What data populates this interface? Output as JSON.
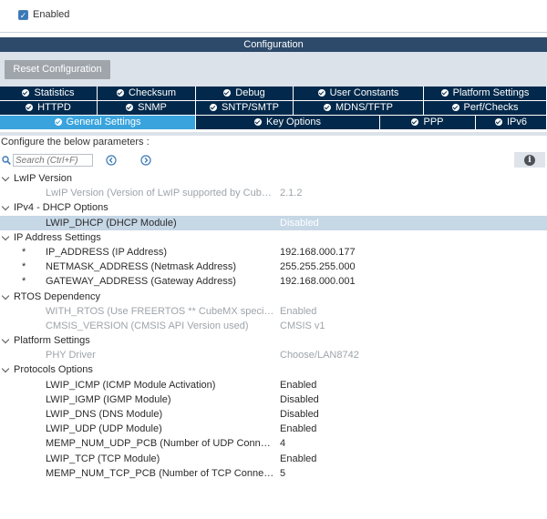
{
  "enabled": {
    "label": "Enabled",
    "checked": true
  },
  "config_header": "Configuration",
  "reset_button": "Reset Configuration",
  "tabs_row1": [
    "Statistics",
    "Checksum",
    "Debug",
    "User Constants",
    "Platform Settings"
  ],
  "tabs_row2": [
    "HTTPD",
    "SNMP",
    "SNTP/SMTP",
    "MDNS/TFTP",
    "Perf/Checks"
  ],
  "tabs_row3": [
    "General Settings",
    "Key Options",
    "PPP",
    "IPv6"
  ],
  "active_tab": "General Settings",
  "configure_label": "Configure the below parameters :",
  "search": {
    "placeholder": "Search (Ctrl+F)"
  },
  "colors": {
    "tab_bg": "#02294b",
    "tab_active": "#39a3dd",
    "header_bg": "#2d4a6a",
    "selected_row": "#c6d7e6"
  },
  "groups": [
    {
      "title": "LwIP Version",
      "params": [
        {
          "name": "LwIP Version (Version of LwIP supported by CubeM...",
          "value": "2.1.2",
          "disabled": true
        }
      ]
    },
    {
      "title": "IPv4 - DHCP Options",
      "params": [
        {
          "name": "LWIP_DHCP (DHCP Module)",
          "value": "Disabled",
          "selected": true
        }
      ]
    },
    {
      "title": "IP Address Settings",
      "params": [
        {
          "name": "IP_ADDRESS (IP Address)",
          "value": "192.168.000.177",
          "star": "*"
        },
        {
          "name": "NETMASK_ADDRESS (Netmask Address)",
          "value": "255.255.255.000",
          "star": "*"
        },
        {
          "name": "GATEWAY_ADDRESS (Gateway Address)",
          "value": "192.168.000.001",
          "star": "*"
        }
      ]
    },
    {
      "title": "RTOS Dependency",
      "params": [
        {
          "name": "WITH_RTOS (Use FREERTOS ** CubeMX specific **)",
          "value": "Enabled",
          "disabled": true
        },
        {
          "name": "CMSIS_VERSION (CMSIS API Version used)",
          "value": "CMSIS v1",
          "disabled": true
        }
      ]
    },
    {
      "title": "Platform Settings",
      "params": [
        {
          "name": "PHY Driver",
          "value": "Choose/LAN8742",
          "disabled": true
        }
      ]
    },
    {
      "title": "Protocols Options",
      "params": [
        {
          "name": "LWIP_ICMP (ICMP Module Activation)",
          "value": "Enabled"
        },
        {
          "name": "LWIP_IGMP (IGMP Module)",
          "value": "Disabled"
        },
        {
          "name": "LWIP_DNS (DNS Module)",
          "value": "Disabled"
        },
        {
          "name": "LWIP_UDP (UDP Module)",
          "value": "Enabled"
        },
        {
          "name": "MEMP_NUM_UDP_PCB (Number of UDP Connectio...",
          "value": "4"
        },
        {
          "name": "LWIP_TCP (TCP Module)",
          "value": "Enabled"
        },
        {
          "name": "MEMP_NUM_TCP_PCB (Number of TCP Connectio...",
          "value": "5"
        }
      ]
    }
  ]
}
